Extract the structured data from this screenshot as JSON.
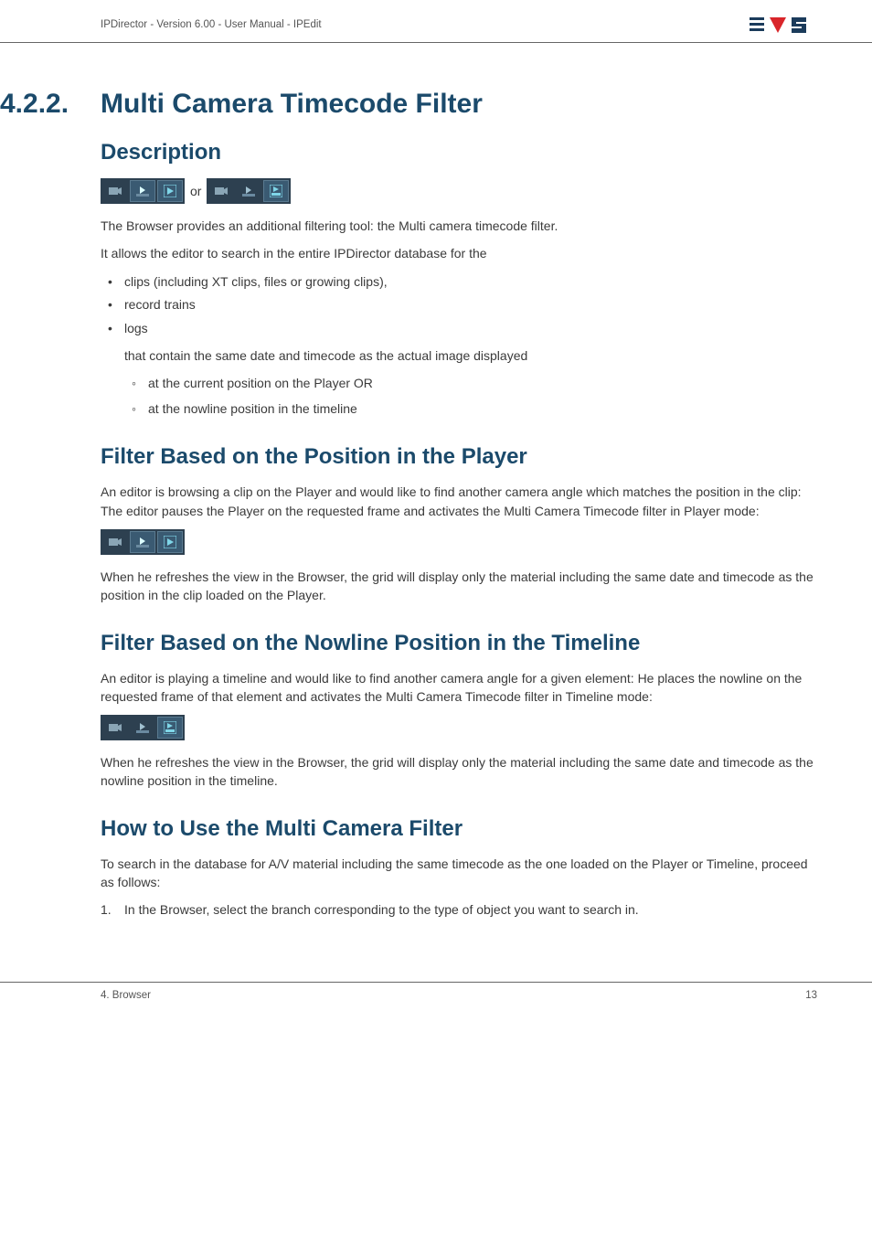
{
  "header": {
    "breadcrumb": "IPDirector - Version 6.00 - User Manual - IPEdit"
  },
  "section": {
    "number": "4.2.2.",
    "title": "Multi Camera Timecode Filter"
  },
  "headings": {
    "description": "Description",
    "filterPlayer": "Filter Based on the Position in the Player",
    "filterNowline": "Filter Based on the Nowline Position in the Timeline",
    "howTo": "How to Use the Multi Camera Filter"
  },
  "desc": {
    "orLabel": "or",
    "p1": "The Browser provides an additional filtering tool: the Multi camera timecode filter.",
    "p2": "It allows the editor to search in the entire IPDirector database for the",
    "b1": "clips (including XT clips, files or growing clips),",
    "b2": "record trains",
    "b3": "logs",
    "b3sub": "that contain the same date and timecode as the actual image displayed",
    "sub1": "at the current position on the Player OR",
    "sub2": "at the nowline position in the timeline"
  },
  "player": {
    "p1": "An editor is browsing a clip on the Player and would like to find another camera angle which matches the position in the clip: The editor pauses the Player on the requested frame and activates the Multi Camera Timecode filter in Player mode:",
    "p2": "When he refreshes the view in the Browser, the grid will display only the material including the same date and timecode as the position in the clip loaded on the Player."
  },
  "nowline": {
    "p1": "An editor is playing a timeline and would like to find another camera angle for a given element: He places the nowline on the requested frame of that element and activates the Multi Camera Timecode filter in Timeline mode:",
    "p2": "When he refreshes the view in the Browser, the grid will display only the material including the same date and timecode as the nowline position in the timeline."
  },
  "howto": {
    "p1": "To search in the database for A/V material including the same timecode as the one loaded on the Player or Timeline, proceed as follows:",
    "step1": "In the Browser, select the branch corresponding to the type of object you want to search in."
  },
  "footer": {
    "left": "4. Browser",
    "right": "13"
  }
}
